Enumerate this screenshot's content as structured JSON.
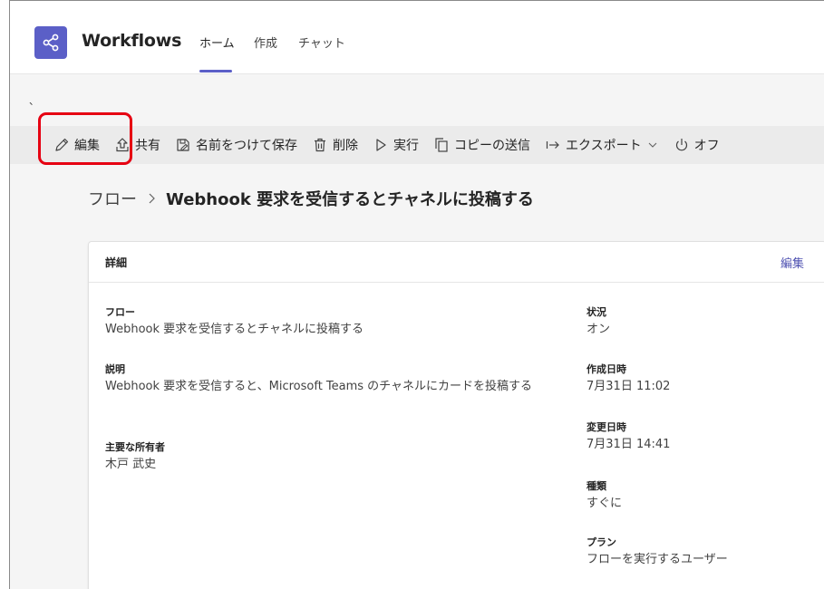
{
  "theme": {
    "accent": "#5b5fc7",
    "highlight": "#e60012",
    "link": "#4f52b2"
  },
  "header": {
    "app_icon": "share-nodes-icon",
    "app_title": "Workflows",
    "tabs": [
      {
        "label": "ホーム",
        "active": true
      },
      {
        "label": "作成",
        "active": false
      },
      {
        "label": "チャット",
        "active": false
      }
    ]
  },
  "stray_mark": "、",
  "toolbar": {
    "items": [
      {
        "label": "編集",
        "icon": "pencil-icon"
      },
      {
        "label": "共有",
        "icon": "share-icon"
      },
      {
        "label": "名前をつけて保存",
        "icon": "save-as-icon"
      },
      {
        "label": "削除",
        "icon": "trash-icon"
      },
      {
        "label": "実行",
        "icon": "play-icon"
      },
      {
        "label": "コピーの送信",
        "icon": "copy-icon"
      },
      {
        "label": "エクスポート",
        "icon": "export-icon"
      },
      {
        "label": "オフ",
        "icon": "power-icon"
      }
    ]
  },
  "breadcrumb": {
    "root": "フロー",
    "separator_icon": "chevron-right-icon",
    "current": "Webhook 要求を受信するとチャネルに投稿する"
  },
  "details": {
    "title": "詳細",
    "edit_label": "編集",
    "left": [
      {
        "label": "フロー",
        "value": "Webhook 要求を受信するとチャネルに投稿する"
      },
      {
        "label": "説明",
        "value": "Webhook 要求を受信すると、Microsoft Teams のチャネルにカードを投稿する"
      },
      {
        "label": "主要な所有者",
        "value": "木戸 武史"
      }
    ],
    "right": [
      {
        "label": "状況",
        "value": "オン"
      },
      {
        "label": "作成日時",
        "value": "7月31日 11:02"
      },
      {
        "label": "変更日時",
        "value": "7月31日 14:41"
      },
      {
        "label": "種類",
        "value": "すぐに"
      },
      {
        "label": "プラン",
        "value": "フローを実行するユーザー"
      }
    ]
  }
}
